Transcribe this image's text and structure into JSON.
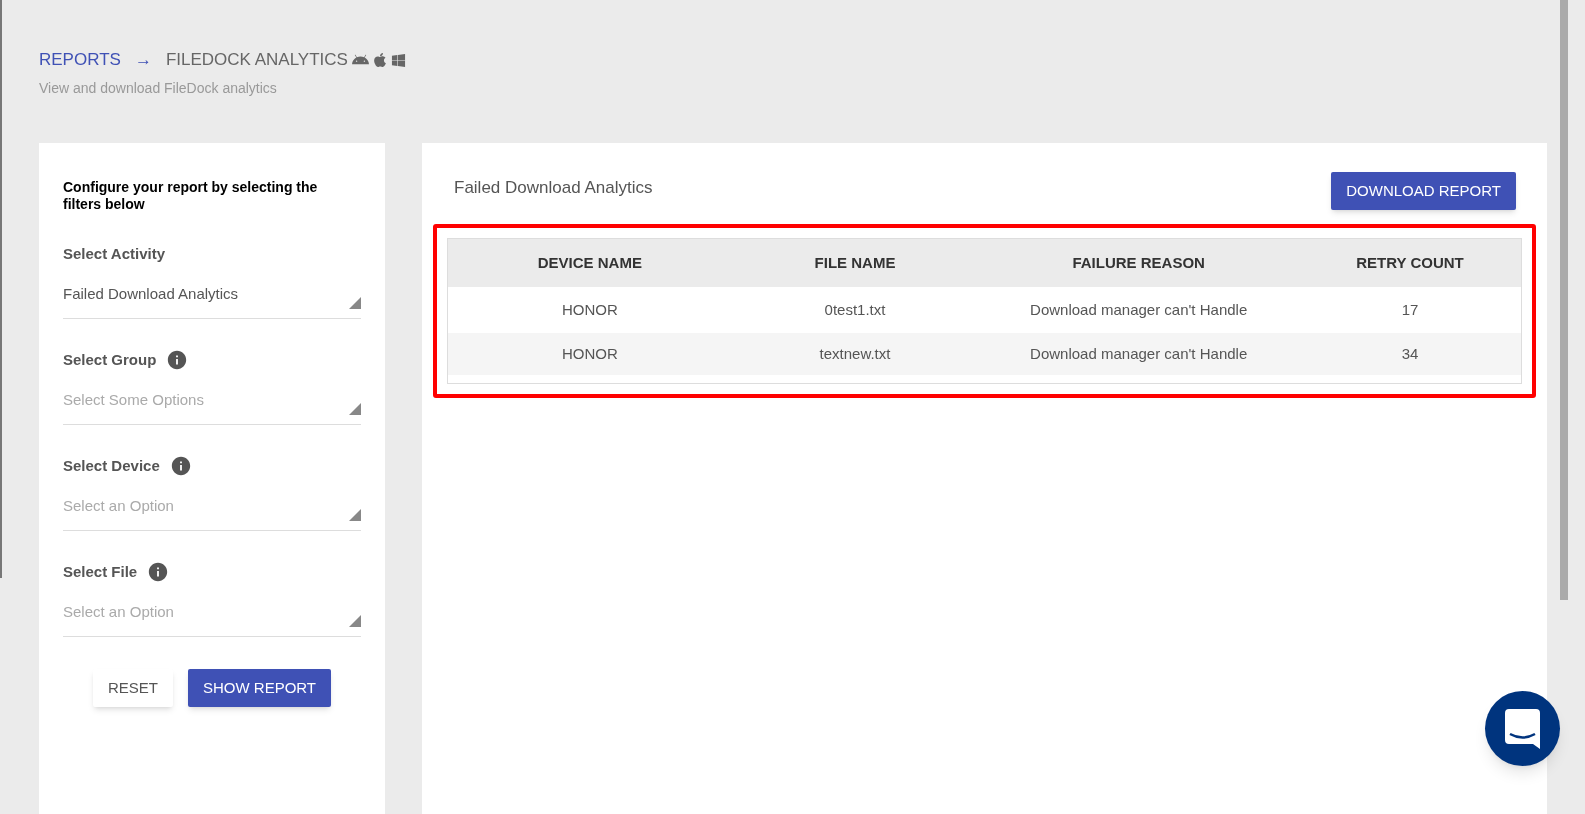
{
  "breadcrumb": {
    "parent": "REPORTS",
    "separator": "→",
    "current": "FILEDOCK ANALYTICS"
  },
  "subtitle": "View and download FileDock analytics",
  "filter_panel": {
    "intro": "Configure your report by selecting the filters below",
    "filters": [
      {
        "label": "Select Activity",
        "info": false,
        "value": "Failed Download Analytics"
      },
      {
        "label": "Select Group",
        "info": true,
        "placeholder": "Select Some Options"
      },
      {
        "label": "Select Device",
        "info": true,
        "placeholder": "Select an Option"
      },
      {
        "label": "Select File",
        "info": true,
        "placeholder": "Select an Option"
      }
    ],
    "buttons": [
      {
        "label": "RESET",
        "kind": "secondary"
      },
      {
        "label": "SHOW REPORT",
        "kind": "primary"
      }
    ]
  },
  "report": {
    "title": "Failed Download Analytics",
    "download_button": "DOWNLOAD REPORT",
    "highlighted": true,
    "columns": [
      "DEVICE NAME",
      "FILE NAME",
      "FAILURE REASON",
      "RETRY COUNT"
    ],
    "rows": [
      [
        "HONOR",
        "0test1.txt",
        "Download manager can't Handle",
        "17"
      ],
      [
        "HONOR",
        "textnew.txt",
        "Download manager can't Handle",
        "34"
      ]
    ]
  }
}
